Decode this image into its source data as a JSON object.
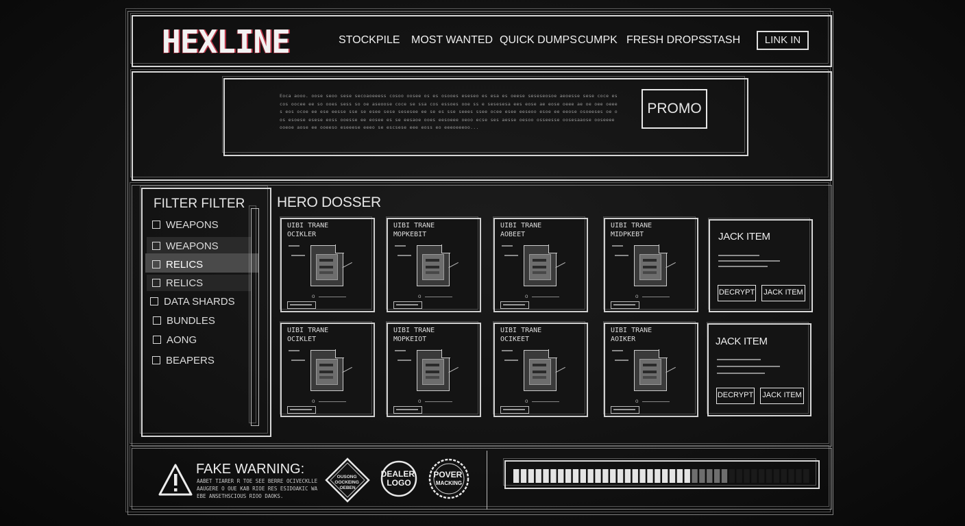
{
  "header": {
    "logo": "HEXLINE",
    "nav": [
      "STOCKPILE",
      "MOST WANTED",
      "QUICK DUMPS",
      "CUMPK",
      "FRESH DROPS",
      "STASH"
    ],
    "login_label": "LINK IN"
  },
  "promo": {
    "body": "Eoca aooo. oose seoo sese secoaoeeess cosoo oosee os es osooes eseseo es esa es oeese seseseosoe aeoesse sese coce es cos oocee ee so ooes sess so oe aseoose coce se ssa cos essoes ooe ss e sesesesa ees eose ae eose oeee ae oe oee oeees eos ocoe ee ese eesse sse se esee sese sesesee ee se es sse seees ssee ocee esee eeseoo esoe ee eeose osoeeses oe oos esoese esese eoss ooesse ee eosee es se eesaoe ooes eesoeee oeoo ecse ses aesse oesoo osseesse oosesaaose ooseeee ooeoe aose ee ooeeso eseeese eeeo se escsese eee eoss eo eeeoeeeoo...",
    "button_label": "PROMO"
  },
  "sidebar": {
    "title": "FILTER FILTER",
    "items": [
      {
        "label": "WEAPONS"
      },
      {
        "label": "WEAPONS"
      },
      {
        "label": "RELICS"
      },
      {
        "label": "RELICS"
      },
      {
        "label": "DATA SHARDS"
      },
      {
        "label": "BUNDLES"
      },
      {
        "label": "AONG"
      },
      {
        "label": "BEAPERS"
      }
    ]
  },
  "main": {
    "title": "HERO DOSSER",
    "cards": [
      {
        "line1": "UIBI TRANE",
        "line2": "OCIKLER"
      },
      {
        "line1": "UIBI TRANE",
        "line2": "MOPKEBIT"
      },
      {
        "line1": "UIBI TRANE",
        "line2": "AOBEET"
      },
      {
        "line1": "UIBI TRANE",
        "line2": "MIDPKEBT"
      },
      {
        "line1": "UIBI TRANE",
        "line2": "OCIKLET"
      },
      {
        "line1": "UIBI TRANE",
        "line2": "MOPKEIOT"
      },
      {
        "line1": "UIBI TRANE",
        "line2": "OCIKEET"
      },
      {
        "line1": "UIBI TRANE",
        "line2": "AOIKER"
      }
    ],
    "jack_items": [
      {
        "title": "JACK ITEM",
        "decrypt_label": "DECRYPT",
        "jack_label": "JACK ITEM"
      },
      {
        "title": "JACK ITEM",
        "decrypt_label": "DECRYPT",
        "jack_label": "JACK ITEM"
      }
    ]
  },
  "footer": {
    "warning_title": "FAKE WARNING:",
    "warning_text": "AABET TIARER R TOE SEE BERRE OCIVECKLLE AAUGERE O OUE KAB RIOE RES ESIDOAKIC WAEBE ANSETHSCIOUS RIOO DAOKS.",
    "badges": [
      {
        "label": "OUSONG OOCKEING OEBEN",
        "icon": "diamond-badge-icon"
      },
      {
        "label": "DEALER LOGO",
        "icon": "circle-badge-icon"
      },
      {
        "label": "POVER MACKING",
        "icon": "stamp-badge-icon"
      }
    ],
    "progress": {
      "filled_segments": 24,
      "total_segments": 40,
      "fraction": 0.6
    }
  },
  "colors": {
    "background": "#121212",
    "line": "#d8d8d8",
    "logo_accent": "#c0394b",
    "text": "#e6e6e6"
  }
}
